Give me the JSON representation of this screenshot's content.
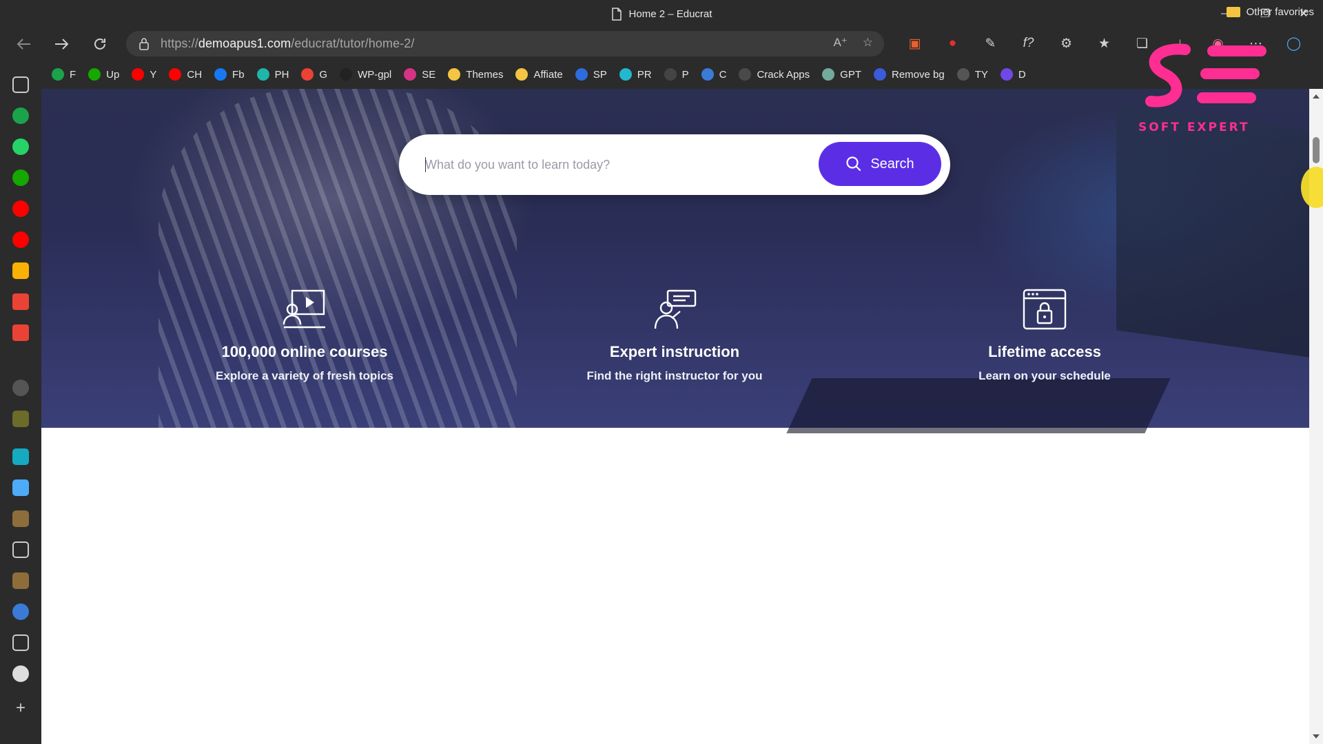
{
  "window": {
    "title": "Home 2 – Educrat"
  },
  "addressbar": {
    "url_prefix": "https://",
    "url_domain": "demoapus1.com",
    "url_path": "/educrat/tutor/home-2/"
  },
  "favorites": {
    "items": [
      {
        "label": "F",
        "color": "#1aa34a"
      },
      {
        "label": "Up",
        "color": "#14a800"
      },
      {
        "label": "Y",
        "color": "#ff0000"
      },
      {
        "label": "CH",
        "color": "#ff0000"
      },
      {
        "label": "Fb",
        "color": "#1877f2"
      },
      {
        "label": "PH",
        "color": "#1fb5a8"
      },
      {
        "label": "G",
        "color": "#ea4335"
      },
      {
        "label": "WP-gpl",
        "color": "#222222"
      },
      {
        "label": "SE",
        "color": "#d63384"
      },
      {
        "label": "Themes",
        "color": "#f4c542"
      },
      {
        "label": "Affiate",
        "color": "#f4c542"
      },
      {
        "label": "SP",
        "color": "#2d6cdf"
      },
      {
        "label": "PR",
        "color": "#22b8cf"
      },
      {
        "label": "P",
        "color": "#444444"
      },
      {
        "label": "C",
        "color": "#3a7bd5"
      },
      {
        "label": "Crack Apps",
        "color": "#4a4a4a"
      },
      {
        "label": "GPT",
        "color": "#74aa9c"
      },
      {
        "label": "Remove bg",
        "color": "#3b5bdb"
      },
      {
        "label": "TY",
        "color": "#555555"
      },
      {
        "label": "D",
        "color": "#7048e8"
      }
    ],
    "other": "Other favorites"
  },
  "hero": {
    "search_placeholder": "What do you want to learn today?",
    "search_button": "Search",
    "features": [
      {
        "title": "100,000 online courses",
        "subtitle": "Explore a variety of fresh topics",
        "icon": "video-course-icon"
      },
      {
        "title": "Expert instruction",
        "subtitle": "Find the right instructor for you",
        "icon": "instructor-icon"
      },
      {
        "title": "Lifetime access",
        "subtitle": "Learn on your schedule",
        "icon": "lock-browser-icon"
      }
    ]
  },
  "watermark": {
    "text": "SOFT EXPERT"
  },
  "colors": {
    "accent": "#5b2ee6",
    "chrome": "#2b2b2b"
  }
}
